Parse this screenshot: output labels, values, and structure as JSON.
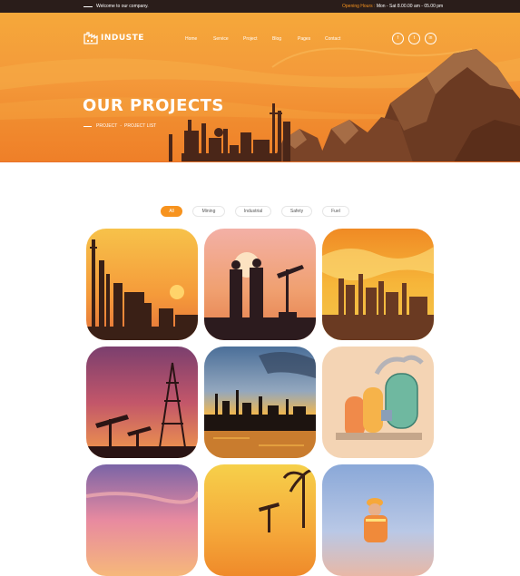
{
  "topbar": {
    "welcome": "Welcome to our company.",
    "hours_label": "Opening Hours :",
    "hours_value": "Mon - Sat 8.00.00 am - 05.00 pm"
  },
  "header": {
    "logo_text": "INDUSTE",
    "nav": [
      "Home",
      "Service",
      "Project",
      "Blog",
      "Pages",
      "Contact"
    ],
    "social": [
      "f",
      "t",
      "in"
    ]
  },
  "hero": {
    "title": "OUR PROJECTS",
    "breadcrumb": [
      "PROJECT",
      "PROJECT LIST"
    ],
    "breadcrumb_sep": "-"
  },
  "filters": [
    "All",
    "Mining",
    "Industrial",
    "Safety",
    "Fuel"
  ],
  "active_filter": "All",
  "projects": [
    {
      "icon": "refinery-sunset-image"
    },
    {
      "icon": "workers-oil-pump-image"
    },
    {
      "icon": "factory-skyline-image"
    },
    {
      "icon": "oil-derrick-image"
    },
    {
      "icon": "refinery-waterfront-image"
    },
    {
      "icon": "chemical-tanks-image"
    },
    {
      "icon": "desert-sunset-image"
    },
    {
      "icon": "oil-pump-palm-image"
    },
    {
      "icon": "engineer-worker-image"
    }
  ],
  "colors": {
    "accent": "#f7931e",
    "topbar": "#2a1d1a"
  }
}
